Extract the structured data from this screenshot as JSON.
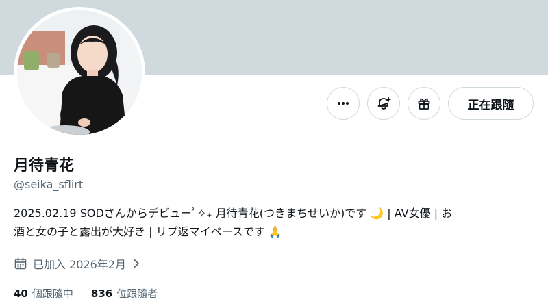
{
  "profile": {
    "display_name": "月待青花",
    "handle": "@seika_sflirt",
    "bio_lines": [
      "2025.02.19 SODさんからデビューﾟ✧₊ 月待青花(つきまちせいか)です 🌙 | AV女優 | お",
      "酒と女の子と露出が大好き | リプ返マイペースです 🙏"
    ],
    "joined": "已加入 2026年2月",
    "following_count": "40",
    "following_label": "個跟隨中",
    "followers_count": "836",
    "followers_label": "位跟隨者"
  },
  "actions": {
    "more_icon": "more-horizontal-icon",
    "notify_icon": "bell-plus-icon",
    "gift_icon": "gift-icon",
    "follow_label": "正在跟隨"
  },
  "colors": {
    "banner": "#cfd9de",
    "text_primary": "#0f1419",
    "text_secondary": "#536471",
    "border": "#cfd9de"
  }
}
